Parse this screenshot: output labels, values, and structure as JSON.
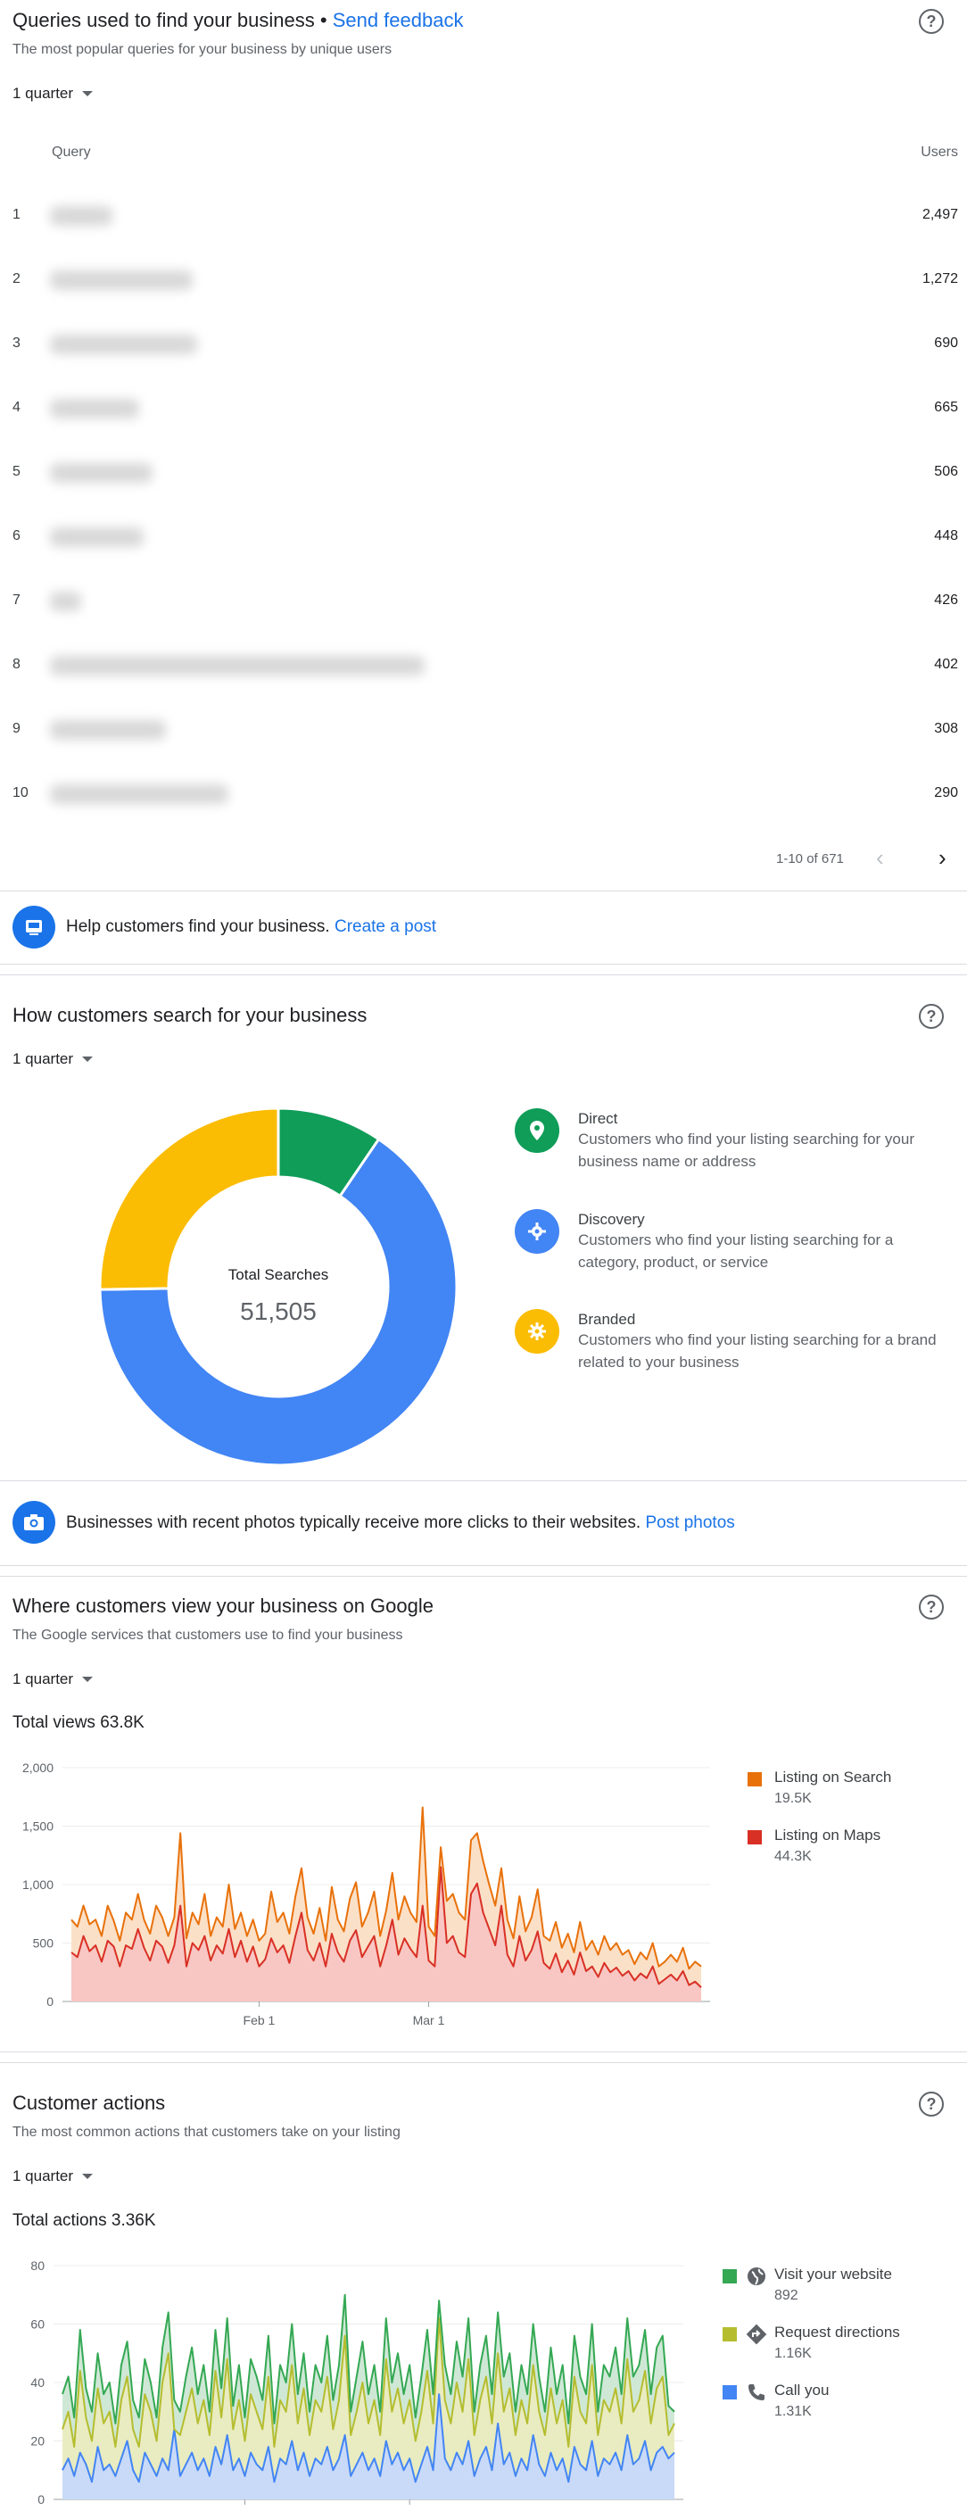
{
  "queries": {
    "title": "Queries used to find your business",
    "separator": " • ",
    "feedback_link": "Send feedback",
    "subtitle": "The most popular queries for your business by unique users",
    "period": "1 quarter",
    "col_query": "Query",
    "col_users": "Users",
    "rows": [
      {
        "idx": "1",
        "users": "2,497"
      },
      {
        "idx": "2",
        "users": "1,272"
      },
      {
        "idx": "3",
        "users": "690"
      },
      {
        "idx": "4",
        "users": "665"
      },
      {
        "idx": "5",
        "users": "506"
      },
      {
        "idx": "6",
        "users": "448"
      },
      {
        "idx": "7",
        "users": "426"
      },
      {
        "idx": "8",
        "users": "402"
      },
      {
        "idx": "9",
        "users": "308"
      },
      {
        "idx": "10",
        "users": "290"
      }
    ],
    "pager": "1-10 of 671",
    "prev_icon": "chevron-left-icon",
    "next_icon": "chevron-right-icon"
  },
  "promo_post": {
    "icon": "post-icon",
    "text": "Help customers find your business. ",
    "link": "Create a post"
  },
  "search": {
    "title": "How customers search for your business",
    "period": "1 quarter",
    "center_label": "Total Searches",
    "center_value": "51,505",
    "legend": [
      {
        "title": "Direct",
        "desc": "Customers who find your listing searching for your business name or address",
        "color": "#0f9d58",
        "icon": "location-pin-icon"
      },
      {
        "title": "Discovery",
        "desc": "Customers who find your listing searching for a category, product, or service",
        "color": "#4285f4",
        "icon": "discovery-icon"
      },
      {
        "title": "Branded",
        "desc": "Customers who find your listing searching for a brand related to your business",
        "color": "#fbbc04",
        "icon": "branded-icon"
      }
    ]
  },
  "promo_photos": {
    "icon": "camera-icon",
    "text": "Businesses with recent photos typically receive more clicks to their websites. ",
    "link": "Post photos"
  },
  "views": {
    "title": "Where customers view your business on Google",
    "subtitle": "The Google services that customers use to find your business",
    "period": "1 quarter",
    "total": "Total views 63.8K",
    "legend": [
      {
        "name": "Listing on Search",
        "value": "19.5K",
        "color": "#e8710a"
      },
      {
        "name": "Listing on Maps",
        "value": "44.3K",
        "color": "#d93025"
      }
    ]
  },
  "actions": {
    "title": "Customer actions",
    "subtitle": "The most common actions that customers take on your listing",
    "period": "1 quarter",
    "total": "Total actions 3.36K",
    "legend": [
      {
        "name": "Visit your website",
        "value": "892",
        "color": "#34a853",
        "icon": "globe-icon"
      },
      {
        "name": "Request directions",
        "value": "1.16K",
        "color": "#b5bd2f",
        "icon": "directions-icon"
      },
      {
        "name": "Call you",
        "value": "1.31K",
        "color": "#4285f4",
        "icon": "phone-icon"
      }
    ]
  },
  "chart_data": [
    {
      "type": "pie",
      "title": "",
      "center_label": "Total Searches",
      "total": 51505,
      "categories": [
        "Direct",
        "Discovery",
        "Branded"
      ],
      "values": [
        4900,
        33600,
        13005
      ],
      "colors": [
        "#0f9d58",
        "#4285f4",
        "#fbbc04"
      ]
    },
    {
      "type": "area",
      "title": "Total views 63.8K",
      "ylim": [
        0,
        2000
      ],
      "yticks": [
        0,
        500,
        1000,
        1500,
        2000
      ],
      "yticklabels": [
        "0",
        "500",
        "1,000",
        "1,500",
        "2,000"
      ],
      "xticks": [
        {
          "day": 31,
          "label": "Feb 1"
        },
        {
          "day": 59,
          "label": "Mar 1"
        }
      ],
      "x_start_label": "",
      "series": [
        {
          "name": "Listing on Maps",
          "color": "#d93025",
          "fill": "#f8c7c3",
          "values": [
            420,
            380,
            560,
            430,
            480,
            340,
            520,
            470,
            300,
            480,
            450,
            620,
            460,
            350,
            520,
            470,
            330,
            480,
            820,
            300,
            500,
            440,
            560,
            350,
            480,
            410,
            620,
            380,
            520,
            340,
            470,
            300,
            360,
            540,
            420,
            480,
            330,
            560,
            760,
            440,
            350,
            500,
            300,
            580,
            420,
            340,
            520,
            610,
            380,
            470,
            560,
            300,
            480,
            700,
            400,
            540,
            450,
            380,
            820,
            350,
            300,
            1150,
            500,
            560,
            420,
            380,
            920,
            1010,
            760,
            620,
            480,
            820,
            400,
            300,
            560,
            350,
            440,
            600,
            330,
            280,
            410,
            250,
            350,
            230,
            420,
            260,
            300,
            210,
            330,
            250,
            290,
            220,
            260,
            180,
            240,
            200,
            300,
            150,
            190,
            230,
            180,
            260,
            140,
            170,
            120
          ]
        },
        {
          "name": "Listing on Search",
          "color": "#e8710a",
          "fill": "#fbe0c8",
          "values": [
            700,
            640,
            820,
            660,
            700,
            560,
            820,
            690,
            520,
            760,
            700,
            920,
            700,
            580,
            820,
            720,
            560,
            720,
            1440,
            540,
            760,
            660,
            920,
            560,
            720,
            640,
            1000,
            620,
            760,
            560,
            700,
            520,
            580,
            940,
            680,
            760,
            580,
            900,
            1140,
            720,
            580,
            800,
            520,
            980,
            700,
            600,
            880,
            1020,
            640,
            760,
            940,
            560,
            780,
            1100,
            700,
            900,
            760,
            680,
            1660,
            640,
            560,
            1320,
            860,
            920,
            760,
            700,
            1380,
            1440,
            1200,
            1000,
            820,
            1140,
            700,
            540,
            900,
            600,
            720,
            960,
            560,
            520,
            680,
            460,
            580,
            420,
            680,
            440,
            520,
            400,
            560,
            440,
            500,
            400,
            440,
            320,
            420,
            360,
            500,
            300,
            340,
            400,
            340,
            460,
            280,
            340,
            300
          ]
        }
      ]
    },
    {
      "type": "area",
      "title": "Total actions 3.36K",
      "ylim": [
        0,
        80
      ],
      "yticks": [
        0,
        20,
        40,
        60,
        80
      ],
      "yticklabels": [
        "0",
        "20",
        "40",
        "60",
        "80"
      ],
      "xticks": [
        {
          "day": 31,
          "label": ""
        },
        {
          "day": 59,
          "label": ""
        }
      ],
      "series": [
        {
          "name": "Call you",
          "color": "#4285f4",
          "fill": "#c9daf8",
          "values": [
            10,
            14,
            8,
            16,
            12,
            6,
            18,
            10,
            12,
            8,
            14,
            20,
            10,
            6,
            16,
            12,
            8,
            14,
            10,
            24,
            8,
            12,
            16,
            10,
            14,
            8,
            18,
            12,
            22,
            10,
            14,
            8,
            16,
            12,
            10,
            18,
            6,
            14,
            12,
            20,
            10,
            16,
            8,
            14,
            12,
            18,
            10,
            14,
            22,
            8,
            12,
            16,
            10,
            14,
            8,
            20,
            12,
            16,
            10,
            14,
            6,
            12,
            18,
            10,
            36,
            14,
            10,
            16,
            12,
            20,
            8,
            14,
            18,
            10,
            26,
            12,
            16,
            8,
            14,
            10,
            22,
            12,
            8,
            16,
            10,
            14,
            6,
            18,
            12,
            10,
            20,
            8,
            14,
            12,
            16,
            10,
            22,
            12,
            14,
            20,
            10,
            16,
            18,
            14,
            16
          ]
        },
        {
          "name": "Request directions",
          "color": "#b5bd2f",
          "fill": "#e9ecc0",
          "values": [
            24,
            30,
            18,
            44,
            28,
            20,
            38,
            26,
            30,
            18,
            34,
            42,
            24,
            18,
            36,
            30,
            20,
            40,
            50,
            24,
            22,
            30,
            38,
            26,
            34,
            22,
            44,
            28,
            48,
            24,
            34,
            20,
            36,
            30,
            24,
            42,
            18,
            34,
            30,
            46,
            26,
            38,
            22,
            34,
            30,
            42,
            24,
            34,
            56,
            22,
            30,
            40,
            26,
            34,
            22,
            48,
            30,
            38,
            26,
            34,
            20,
            30,
            44,
            26,
            62,
            34,
            26,
            40,
            30,
            48,
            22,
            34,
            42,
            26,
            50,
            30,
            38,
            22,
            34,
            26,
            46,
            30,
            22,
            38,
            26,
            34,
            18,
            42,
            30,
            26,
            46,
            22,
            34,
            30,
            38,
            26,
            48,
            30,
            34,
            44,
            26,
            38,
            42,
            22,
            26
          ]
        },
        {
          "name": "Visit your website",
          "color": "#34a853",
          "fill": "#cfe8d6",
          "values": [
            36,
            42,
            28,
            58,
            38,
            30,
            50,
            36,
            40,
            26,
            46,
            54,
            34,
            28,
            48,
            40,
            28,
            52,
            64,
            34,
            30,
            42,
            52,
            36,
            46,
            30,
            58,
            38,
            62,
            32,
            46,
            28,
            48,
            42,
            34,
            56,
            26,
            46,
            40,
            60,
            36,
            50,
            30,
            46,
            40,
            56,
            34,
            46,
            70,
            30,
            42,
            54,
            36,
            46,
            30,
            62,
            40,
            50,
            36,
            46,
            28,
            42,
            58,
            36,
            68,
            46,
            36,
            54,
            42,
            62,
            30,
            46,
            56,
            36,
            64,
            42,
            50,
            30,
            46,
            36,
            60,
            42,
            30,
            52,
            36,
            46,
            26,
            56,
            42,
            36,
            60,
            30,
            46,
            42,
            52,
            36,
            62,
            42,
            46,
            58,
            36,
            52,
            56,
            32,
            30
          ]
        }
      ]
    }
  ]
}
